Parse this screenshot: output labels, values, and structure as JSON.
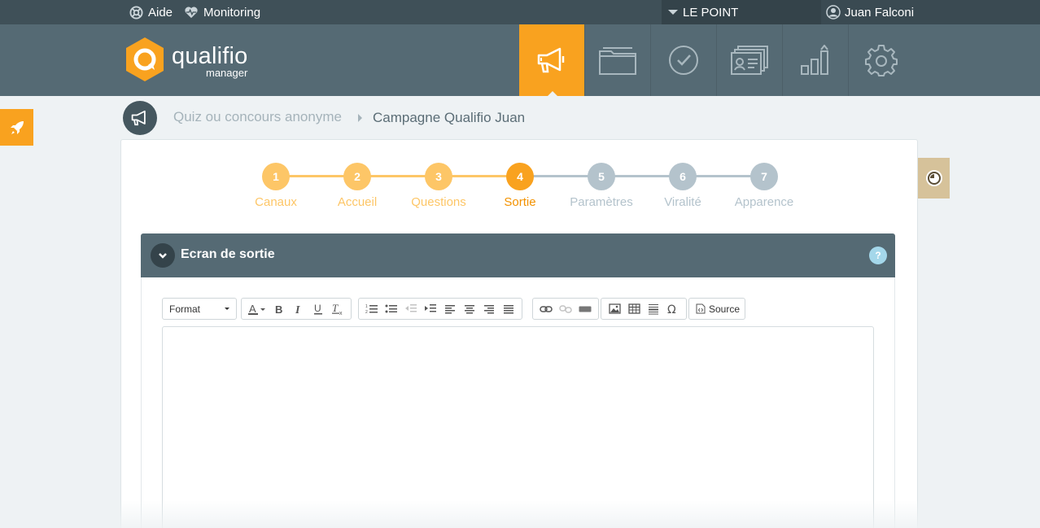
{
  "topbar": {
    "help_label": "Aide",
    "monitoring_label": "Monitoring",
    "brand": "LE POINT",
    "user": "Juan Falconi"
  },
  "logo": {
    "name": "qualifio",
    "tagline": "manager"
  },
  "nav": [
    {
      "icon": "megaphone-icon",
      "active": true
    },
    {
      "icon": "folder-icon",
      "active": false
    },
    {
      "icon": "check-circle-icon",
      "active": false
    },
    {
      "icon": "contacts-card-icon",
      "active": false
    },
    {
      "icon": "bar-chart-icon",
      "active": false
    },
    {
      "icon": "gear-icon",
      "active": false
    }
  ],
  "breadcrumb": {
    "parent": "Quiz ou concours anonyme",
    "current": "Campagne Qualifio Juan"
  },
  "steps": [
    {
      "number": "1",
      "label": "Canaux",
      "state": "done"
    },
    {
      "number": "2",
      "label": "Accueil",
      "state": "done"
    },
    {
      "number": "3",
      "label": "Questions",
      "state": "done"
    },
    {
      "number": "4",
      "label": "Sortie",
      "state": "current"
    },
    {
      "number": "5",
      "label": "Paramètres",
      "state": "todo"
    },
    {
      "number": "6",
      "label": "Viralité",
      "state": "todo"
    },
    {
      "number": "7",
      "label": "Apparence",
      "state": "todo"
    }
  ],
  "section": {
    "title": "Ecran de sortie",
    "help": "?"
  },
  "editor": {
    "format_label": "Format",
    "source_label": "Source",
    "content": ""
  },
  "colors": {
    "accent": "#f9a21f",
    "step_done": "#fdc667",
    "step_todo": "#b4c3cc",
    "header": "#556a74",
    "topbar": "#3f5058"
  }
}
